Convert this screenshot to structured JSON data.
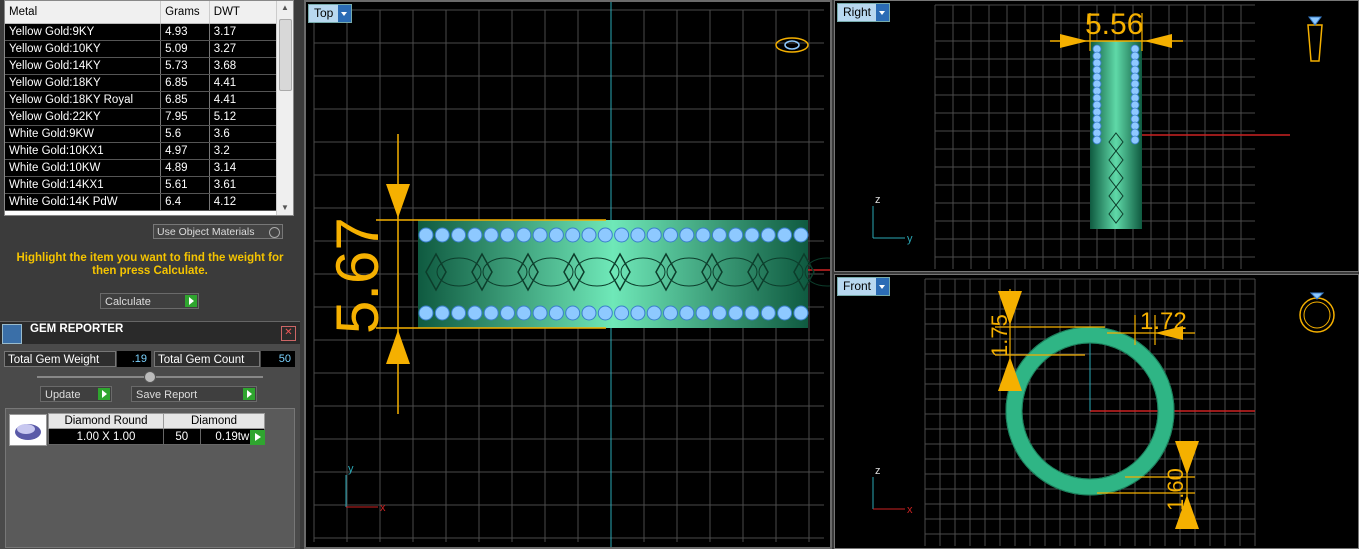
{
  "metal_table": {
    "headers": [
      "Metal",
      "Grams",
      "DWT"
    ],
    "rows": [
      [
        "Yellow Gold:9KY",
        "4.93",
        "3.17"
      ],
      [
        "Yellow Gold:10KY",
        "5.09",
        "3.27"
      ],
      [
        "Yellow Gold:14KY",
        "5.73",
        "3.68"
      ],
      [
        "Yellow Gold:18KY",
        "6.85",
        "4.41"
      ],
      [
        "Yellow Gold:18KY Royal",
        "6.85",
        "4.41"
      ],
      [
        "Yellow Gold:22KY",
        "7.95",
        "5.12"
      ],
      [
        "White Gold:9KW",
        "5.6",
        "3.6"
      ],
      [
        "White Gold:10KX1",
        "4.97",
        "3.2"
      ],
      [
        "White Gold:10KW",
        "4.89",
        "3.14"
      ],
      [
        "White Gold:14KX1",
        "5.61",
        "3.61"
      ],
      [
        "White Gold:14K PdW",
        "6.4",
        "4.12"
      ]
    ]
  },
  "use_object_materials": "Use Object Materials",
  "hint": "Highlight the item you want to find the weight for then press Calculate.",
  "calculate_label": "Calculate",
  "gem_reporter": {
    "title": "GEM REPORTER",
    "total_weight_label": "Total Gem Weight",
    "total_weight_value": ".19",
    "total_count_label": "Total Gem Count",
    "total_count_value": "50",
    "update_label": "Update",
    "save_report_label": "Save Report",
    "gem_headers": [
      "Diamond Round",
      "Diamond"
    ],
    "gem_size": "1.00 X 1.00",
    "gem_count": "50",
    "gem_weight": "0.19tw"
  },
  "viewports": {
    "top_label": "Top",
    "right_label": "Right",
    "front_label": "Front",
    "dims": {
      "top_height": "5.67",
      "right_width": "5.56",
      "front_top": "1.75",
      "front_right": "1.72",
      "front_bottom": "1.60"
    },
    "axes": {
      "x": "x",
      "y": "y",
      "z": "z"
    }
  },
  "colors": {
    "ring_green": "#2fb585",
    "gem_blue": "#8ec9ff",
    "dimension_orange": "#f5b000",
    "grid_line": "#4a4a4a",
    "axis_x": "#cc2222",
    "axis_y": "#2aa7b5"
  }
}
